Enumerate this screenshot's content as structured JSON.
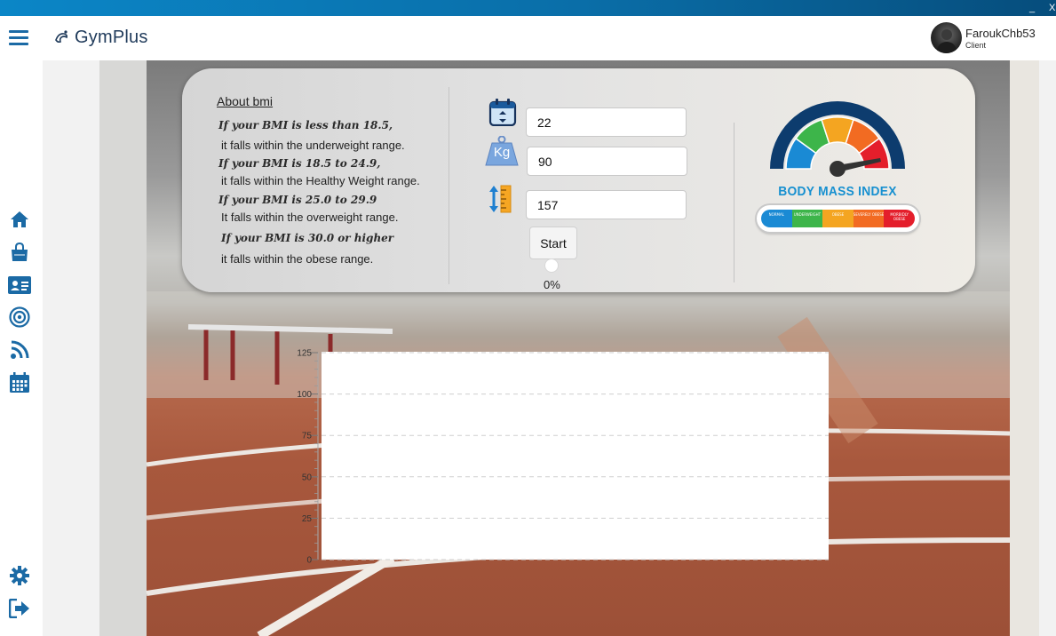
{
  "window": {
    "minimize_label": "_",
    "close_label": "X"
  },
  "header": {
    "app_name": "GymPlus",
    "user": {
      "name": "FaroukChb53",
      "role": "Client"
    }
  },
  "sidebar": {
    "items": [
      {
        "icon": "home-icon"
      },
      {
        "icon": "shopping-bag-icon"
      },
      {
        "icon": "id-card-icon"
      },
      {
        "icon": "target-icon"
      },
      {
        "icon": "rss-icon"
      },
      {
        "icon": "calendar-icon"
      }
    ],
    "bottom": [
      {
        "icon": "gear-icon"
      },
      {
        "icon": "logout-icon"
      }
    ]
  },
  "about": {
    "title": "About bmi",
    "rules": [
      {
        "condition": "If your BMI is less than 18.5,",
        "text": "it falls within the underweight range."
      },
      {
        "condition": "If your BMI is 18.5 to 24.9,",
        "text": "it falls within the Healthy Weight range."
      },
      {
        "condition": "If your BMI is 25.0 to 29.9",
        "text": "It falls within the overweight range."
      },
      {
        "condition": "If your BMI is 30.0 or higher",
        "text": "it falls within the obese range."
      }
    ]
  },
  "form": {
    "age": "22",
    "weight": "90",
    "height": "157",
    "weight_icon_text": "Kg",
    "start_label": "Start",
    "progress": 0,
    "progress_text": "0%"
  },
  "bmi_image": {
    "title": "BODY MASS INDEX",
    "scale_labels": [
      "NORMAL",
      "UNDERWEIGHT",
      "OBESE",
      "SEVERELY OBESE",
      "MORBIDLY OBESE"
    ],
    "colors": [
      "#1a8ad4",
      "#3db54a",
      "#f4a521",
      "#f26b22",
      "#e41e2b"
    ]
  },
  "chart_data": {
    "type": "line",
    "series": [],
    "x": [],
    "yticks": [
      0,
      25,
      50,
      75,
      100,
      125
    ],
    "ylim": [
      0,
      125
    ],
    "grid": true
  }
}
